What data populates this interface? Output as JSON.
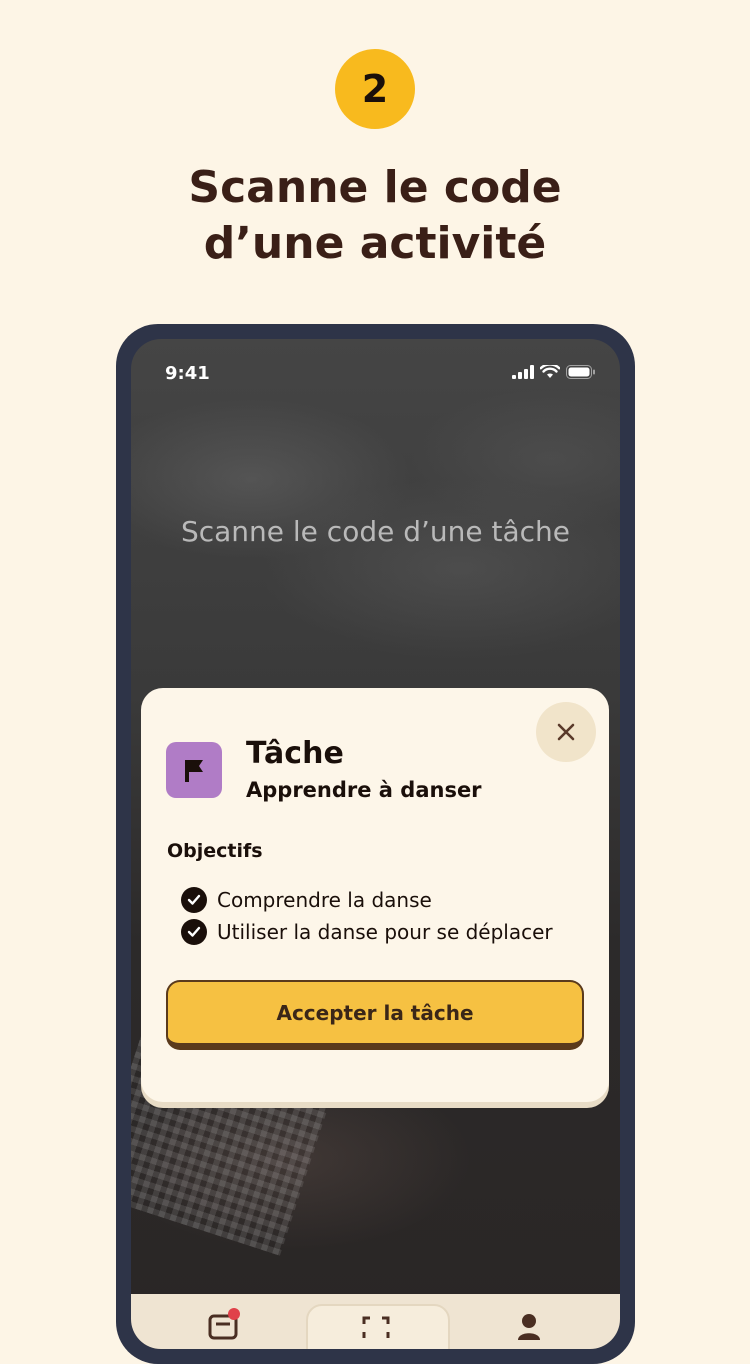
{
  "step": {
    "number": "2"
  },
  "headline": {
    "line1": "Scanne le code",
    "line2": "d’une activité"
  },
  "status_bar": {
    "time": "9:41"
  },
  "scanner": {
    "hint": "Scanne le code d’une tâche"
  },
  "card": {
    "type": "Tâche",
    "name": "Apprendre à danser",
    "objectives_title": "Objectifs",
    "objectives": [
      "Comprendre la danse",
      "Utiliser la danse pour se déplacer"
    ],
    "accept_label": "Accepter la tâche",
    "icon": "flag-icon",
    "close_icon": "close-icon"
  },
  "colors": {
    "background": "#FDF5E6",
    "accent_yellow": "#F8BA1E",
    "task_purple": "#B07CC6",
    "button_yellow": "#F6C142",
    "text_dark": "#3A1F17"
  },
  "nav": {
    "items": [
      {
        "icon": "messages-icon",
        "has_badge": true
      },
      {
        "icon": "scan-icon",
        "active": true
      },
      {
        "icon": "profile-icon"
      }
    ]
  }
}
